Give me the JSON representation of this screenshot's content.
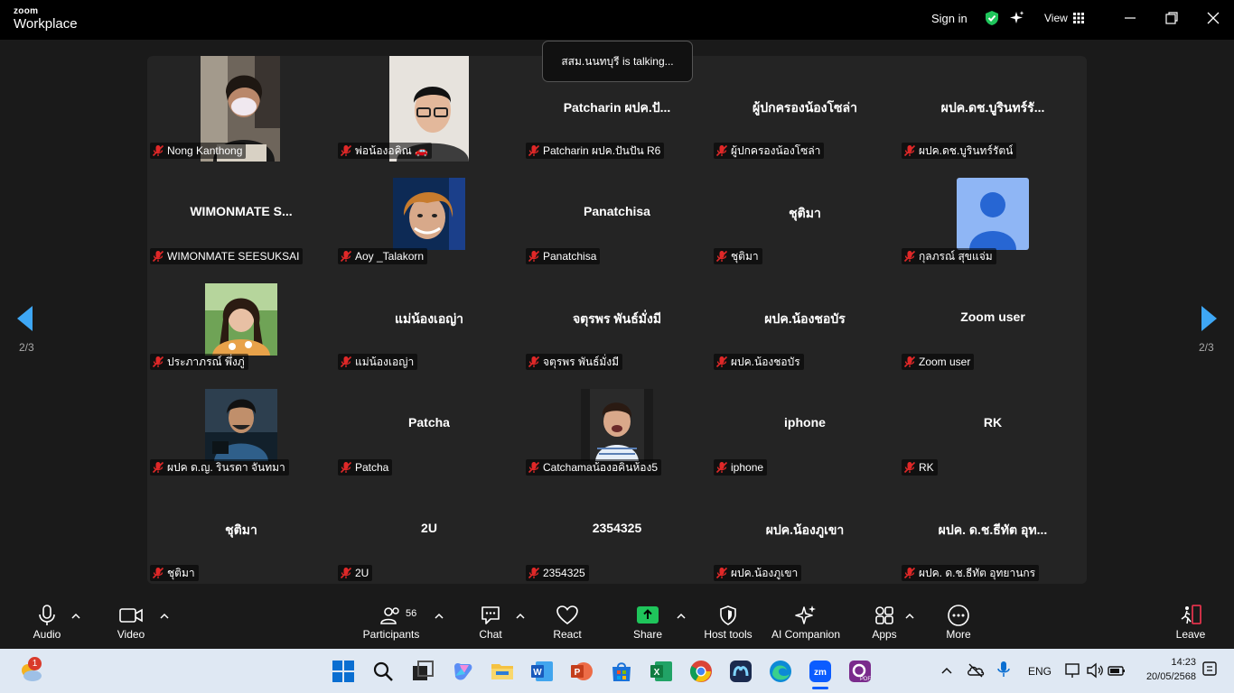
{
  "app": {
    "brand_small": "zoom",
    "brand_large": "Workplace",
    "sign_in": "Sign in",
    "view": "View"
  },
  "talking_indicator": "สสม.นนทบุรี is talking...",
  "page_indicator": "2/3",
  "participants": [
    {
      "label": "Nong Kanthong",
      "name": "",
      "video": "person-mask"
    },
    {
      "label": "พ่อน้องอคิณ 🚗",
      "name": "",
      "video": "man-glasses"
    },
    {
      "label": "Patcharin ผปค.ปันปัน R6",
      "name": "Patcharin ผปค.ปั...",
      "video": ""
    },
    {
      "label": "ผู้ปกครองน้องโซล่า",
      "name": "ผู้ปกครองน้องโซล่า",
      "video": ""
    },
    {
      "label": "ผปค.ดช.บูรินทร์รัตน์",
      "name": "ผปค.ดช.บูรินทร์รั...",
      "video": ""
    },
    {
      "label": "WIMONMATE SEESUKSAI",
      "name": "WIMONMATE S...",
      "video": ""
    },
    {
      "label": "Aoy _Talakorn",
      "name": "",
      "video": "woman-short-hair"
    },
    {
      "label": "Panatchisa",
      "name": "Panatchisa",
      "video": ""
    },
    {
      "label": "ชุติมา",
      "name": "ชุติมา",
      "video": ""
    },
    {
      "label": "กุลภรณ์ สุขแจ่ม",
      "name": "",
      "video": "avatar"
    },
    {
      "label": "ประภาภรณ์ พึ่งภู่",
      "name": "",
      "video": "woman-long-hair"
    },
    {
      "label": "แม่น้องเอญ่า",
      "name": "แม่น้องเอญ่า",
      "video": ""
    },
    {
      "label": "จตุรพร พันธ์มั่งมี",
      "name": "จตุรพร พันธ์มั่งมี",
      "video": ""
    },
    {
      "label": "ผปค.น้องชอบัร",
      "name": "ผปค.น้องชอบัร",
      "video": ""
    },
    {
      "label": "Zoom user",
      "name": "Zoom user",
      "video": ""
    },
    {
      "label": "ผปค ด.ญ. รินรดา จันทมา",
      "name": "",
      "video": "man-cartoon"
    },
    {
      "label": "Patcha",
      "name": "Patcha",
      "video": ""
    },
    {
      "label": "Catchamaน้องอคินห้อง5",
      "name": "",
      "video": "child"
    },
    {
      "label": "iphone",
      "name": "iphone",
      "video": ""
    },
    {
      "label": "RK",
      "name": "RK",
      "video": ""
    },
    {
      "label": "ชุติมา",
      "name": "ชุติมา",
      "video": ""
    },
    {
      "label": "2U",
      "name": "2U",
      "video": ""
    },
    {
      "label": "2354325",
      "name": "2354325",
      "video": ""
    },
    {
      "label": "ผปค.น้องภูเขา",
      "name": "ผปค.น้องภูเขา",
      "video": ""
    },
    {
      "label": "ผปค. ด.ช.ธีทัต อุทยานกร",
      "name": "ผปค. ด.ช.ธีทัต อุท...",
      "video": ""
    }
  ],
  "toolbar": {
    "audio": "Audio",
    "video": "Video",
    "participants": "Participants",
    "participants_count": "56",
    "chat": "Chat",
    "react": "React",
    "share": "Share",
    "host_tools": "Host tools",
    "ai_companion": "AI Companion",
    "apps": "Apps",
    "more": "More",
    "leave": "Leave"
  },
  "taskbar": {
    "notification_count": "1",
    "language": "ENG",
    "time": "14:23",
    "date": "20/05/2568"
  },
  "colors": {
    "accent_blue": "#3ea7f5",
    "share_green": "#1fc55b",
    "leave_red": "#e0324b",
    "mic_off_red": "#e02828"
  }
}
